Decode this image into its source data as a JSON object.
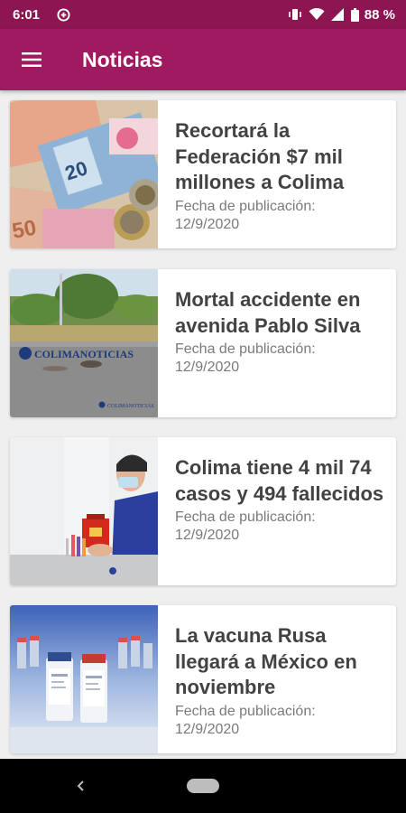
{
  "status_bar": {
    "time": "6:01",
    "battery": "88 %",
    "icons": [
      "data-saver-icon",
      "vibrate-icon",
      "wifi-icon",
      "signal-icon",
      "battery-icon"
    ]
  },
  "app_bar": {
    "title": "Noticias",
    "menu_icon": "hamburger-menu-icon",
    "color": "#a01a5f"
  },
  "news": [
    {
      "title": "Recortará la Federación $7 mil millones a Colima",
      "date_label": "Fecha de publicación:",
      "date": "12/9/2020",
      "image": "pesos-banknotes-image"
    },
    {
      "title": "Mortal accidente en avenida Pablo Silva",
      "date_label": "Fecha de publicación:",
      "date": "12/9/2020",
      "image": "road-accident-image",
      "image_watermark": "COLIMANOTICIAS"
    },
    {
      "title": "Colima tiene 4 mil 74 casos y 494 fallecidos",
      "date_label": "Fecha de publicación:",
      "date": "12/9/2020",
      "image": "health-worker-lab-image"
    },
    {
      "title": "La vacuna Rusa llegará a México en noviembre",
      "date_label": "Fecha de publicación:",
      "date": "12/9/2020",
      "image": "vaccine-vials-image"
    }
  ],
  "nav_bar": {
    "back_icon": "back-arrow-icon",
    "home_icon": "home-pill-icon"
  }
}
